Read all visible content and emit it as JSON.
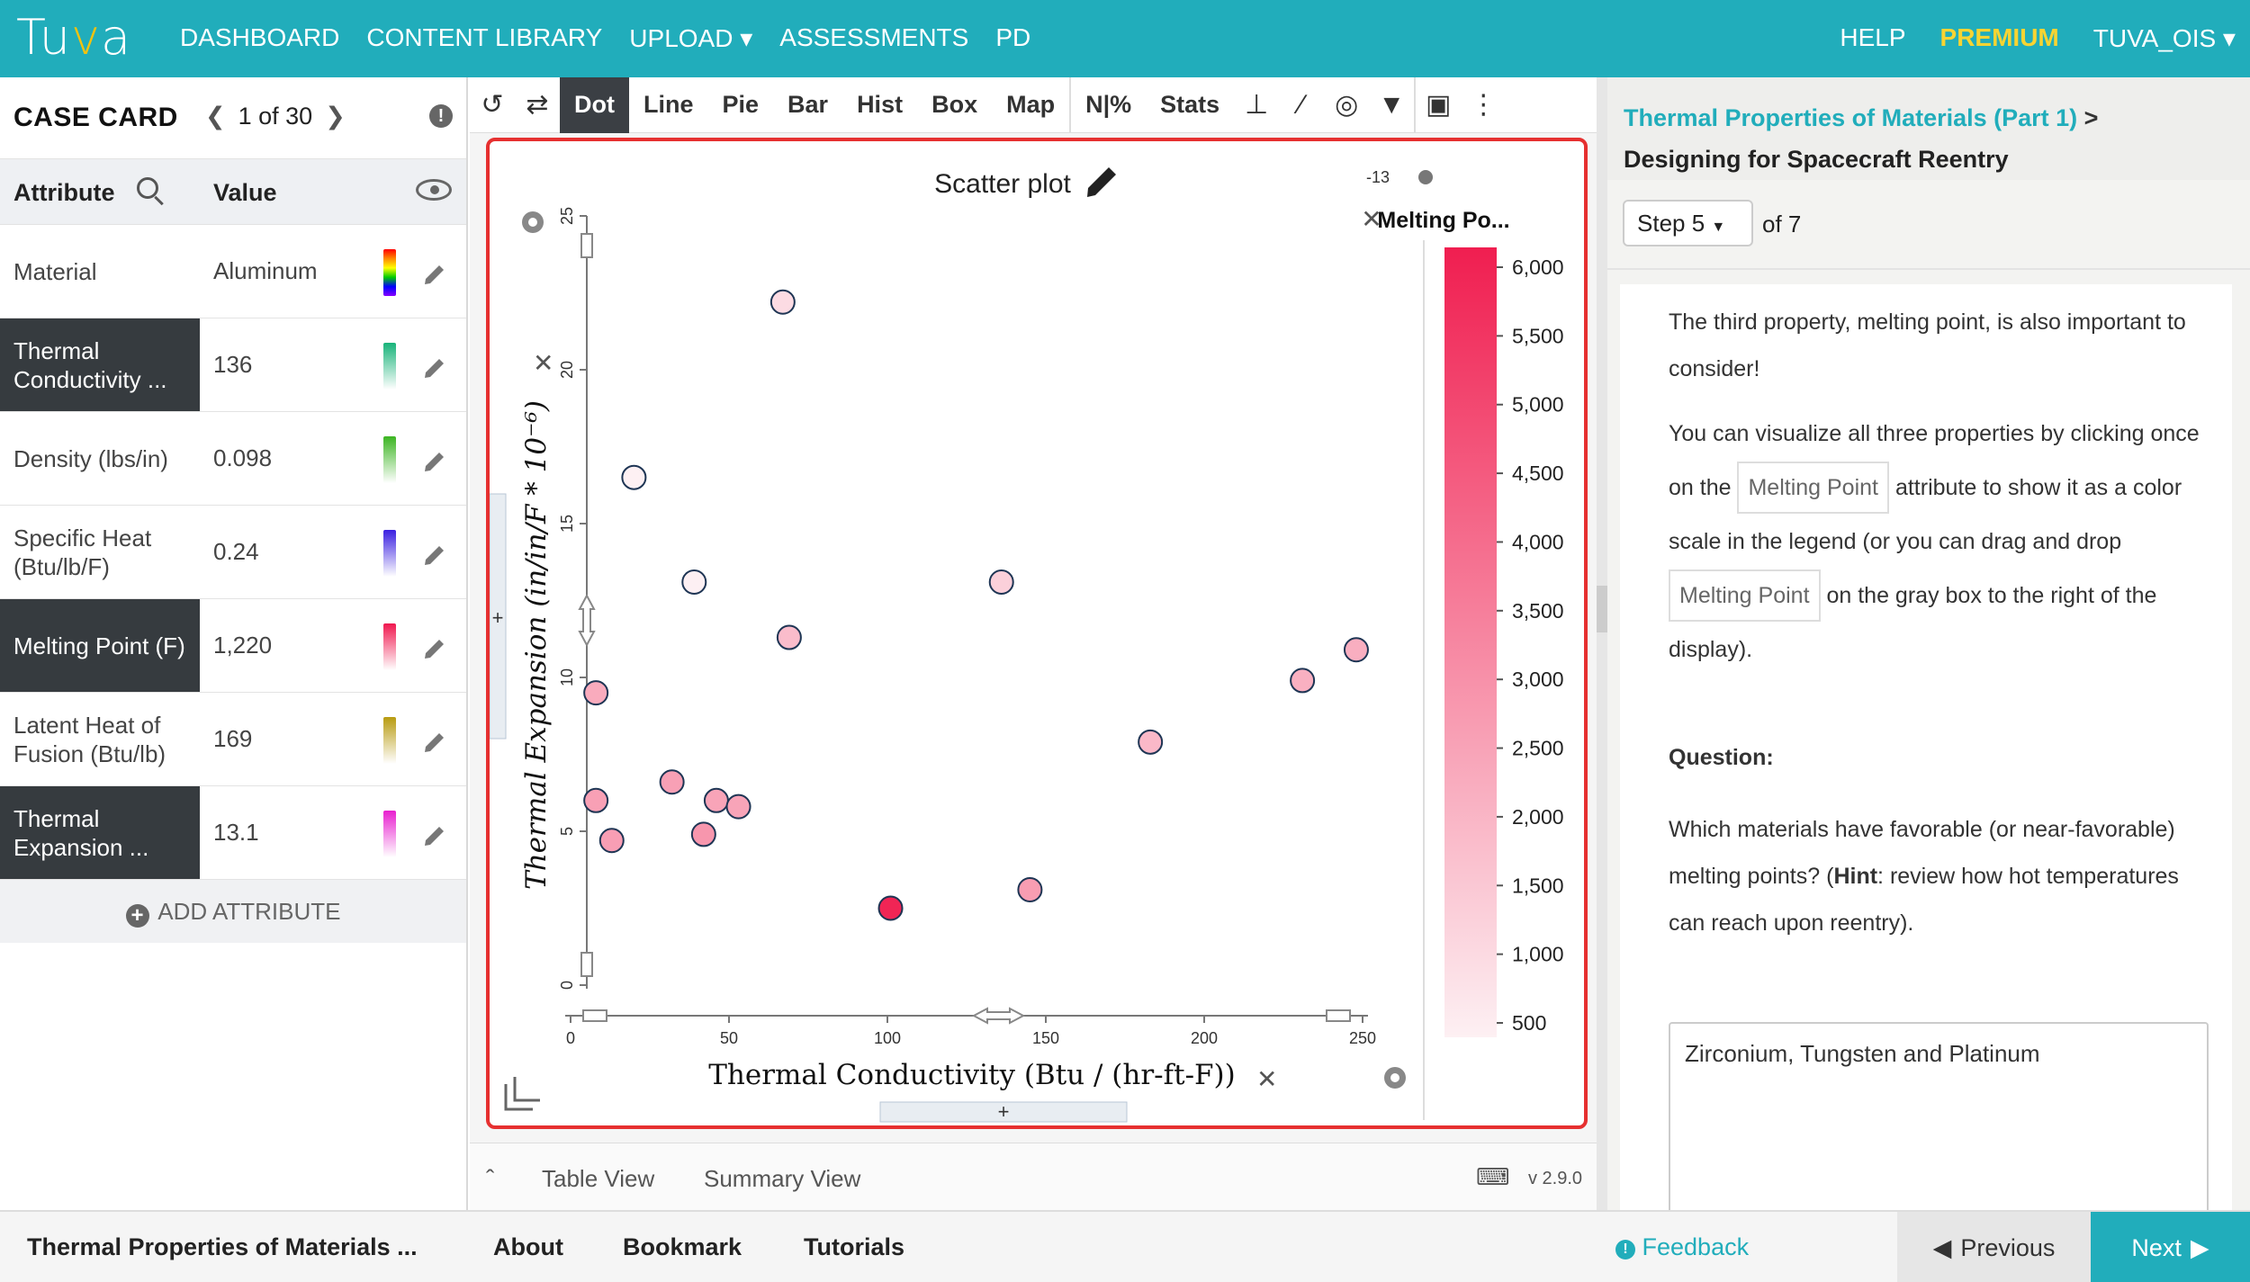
{
  "nav": {
    "logo": "Tuva",
    "items": [
      "DASHBOARD",
      "CONTENT LIBRARY",
      "UPLOAD ▾",
      "ASSESSMENTS",
      "PD"
    ],
    "help": "HELP",
    "premium": "PREMIUM",
    "user": "TUVA_OIS ▾"
  },
  "case_card": {
    "title": "CASE CARD",
    "position": "1 of 30",
    "col_attribute": "Attribute",
    "col_value": "Value",
    "rows": [
      {
        "name": "Material",
        "value": "Aluminum",
        "selected": false,
        "swatch": "rainbow"
      },
      {
        "name": "Thermal Conductivity ...",
        "value": "136",
        "selected": true,
        "swatch": "#18b37a"
      },
      {
        "name": "Density (lbs/in)",
        "value": "0.098",
        "selected": false,
        "swatch": "#3cb522"
      },
      {
        "name": "Specific Heat (Btu/lb/F)",
        "value": "0.24",
        "selected": false,
        "swatch": "#3a1fe0"
      },
      {
        "name": "Melting Point (F)",
        "value": "1,220",
        "selected": true,
        "swatch": "#f0184f"
      },
      {
        "name": "Latent Heat of Fusion (Btu/lb)",
        "value": "169",
        "selected": false,
        "swatch": "#b89b10"
      },
      {
        "name": "Thermal Expansion ...",
        "value": "13.1",
        "selected": true,
        "swatch": "#e81fcf"
      }
    ],
    "add_attribute": "ADD ATTRIBUTE"
  },
  "toolbar": {
    "buttons": [
      "Dot",
      "Line",
      "Pie",
      "Bar",
      "Hist",
      "Box",
      "Map",
      "N|%",
      "Stats"
    ],
    "active": "Dot"
  },
  "graph": {
    "title": "Scatter plot",
    "count_label": "-13",
    "legend_title": "Melting Po...",
    "x_axis_label": "Thermal Conductivity (Btu / (hr-ft-F))",
    "y_axis_label": "Thermal Expansion (in/in/F * 10⁻⁶)"
  },
  "chart_data": {
    "type": "scatter",
    "title": "Scatter plot",
    "xlabel": "Thermal Conductivity (Btu / (hr-ft-F))",
    "ylabel": "Thermal Expansion (in/in/F * 10^-6)",
    "xlim": [
      0,
      250
    ],
    "ylim": [
      0,
      25
    ],
    "x_ticks": [
      0,
      50,
      100,
      150,
      200,
      250
    ],
    "y_ticks": [
      0,
      5,
      10,
      15,
      20,
      25
    ],
    "color_scale": {
      "attribute": "Melting Point (F)",
      "range": [
        300,
        6350
      ],
      "ticks": [
        "6,000",
        "5,500",
        "5,000",
        "4,500",
        "4,000",
        "3,500",
        "3,000",
        "2,500",
        "2,000",
        "1,500",
        "1,000",
        "500"
      ],
      "low_color": "#fdf0f3",
      "high_color": "#f01e50"
    },
    "points": [
      {
        "x": 67,
        "y": 22.2,
        "c": 900
      },
      {
        "x": 20,
        "y": 16.5,
        "c": 300
      },
      {
        "x": 39,
        "y": 13.1,
        "c": 300
      },
      {
        "x": 136,
        "y": 13.1,
        "c": 1220
      },
      {
        "x": 69,
        "y": 11.3,
        "c": 1800
      },
      {
        "x": 8,
        "y": 9.5,
        "c": 2300
      },
      {
        "x": 248,
        "y": 10.9,
        "c": 2200
      },
      {
        "x": 231,
        "y": 9.9,
        "c": 2150
      },
      {
        "x": 183,
        "y": 7.9,
        "c": 1900
      },
      {
        "x": 32,
        "y": 6.6,
        "c": 2600
      },
      {
        "x": 8,
        "y": 6.0,
        "c": 2600
      },
      {
        "x": 46,
        "y": 6.0,
        "c": 2500
      },
      {
        "x": 53,
        "y": 5.8,
        "c": 2500
      },
      {
        "x": 13,
        "y": 4.7,
        "c": 2650
      },
      {
        "x": 42,
        "y": 4.9,
        "c": 2900
      },
      {
        "x": 145,
        "y": 3.1,
        "c": 2700
      },
      {
        "x": 101,
        "y": 2.5,
        "c": 6150
      }
    ]
  },
  "bottom_tabs": {
    "table_view": "Table View",
    "summary_view": "Summary View",
    "version": "v 2.9.0"
  },
  "lesson": {
    "title": "Thermal Properties of Materials (Part 1)",
    "title_sep": ">",
    "subtitle": "Designing for Spacecraft Reentry",
    "step_select": "Step 5",
    "step_of": "of 7",
    "para1": "The third property, melting point, is also important to consider!",
    "para2_a": "You can visualize all three properties by clicking once on the",
    "chip": "Melting Point",
    "para2_b": "attribute to show it as a color scale in the legend (or you can drag and drop",
    "para2_c": "on the gray box to the right of the display).",
    "question_label": "Question:",
    "question_a": "Which materials have favorable (or near-favorable) melting points? (",
    "hint": "Hint",
    "question_b": ": review how hot temperatures can reach upon reentry).",
    "answer": "Zirconium, Tungsten and Platinum"
  },
  "footer": {
    "title": "Thermal Properties of Materials ...",
    "about": "About",
    "bookmark": "Bookmark",
    "tutorials": "Tutorials",
    "feedback": "Feedback",
    "previous": "Previous",
    "next": "Next"
  }
}
